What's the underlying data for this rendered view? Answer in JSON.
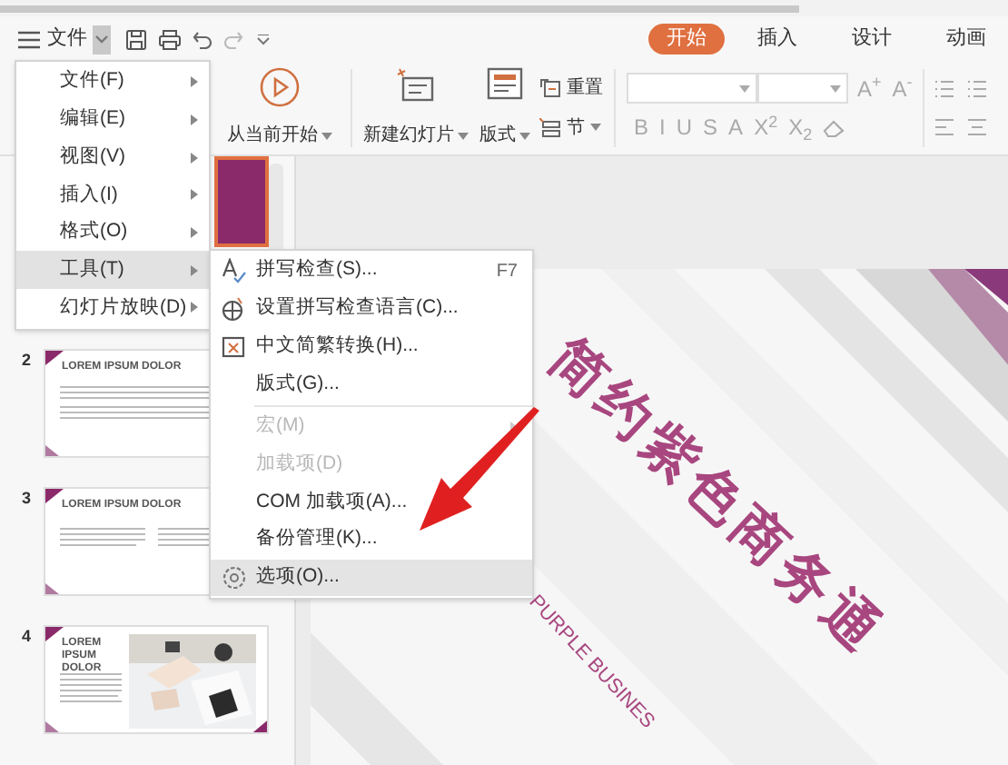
{
  "toolbar": {
    "menu_label": "文件"
  },
  "tabs": [
    {
      "label": "开始",
      "selected": true
    },
    {
      "label": "插入",
      "selected": false
    },
    {
      "label": "设计",
      "selected": false
    },
    {
      "label": "动画",
      "selected": false
    }
  ],
  "ribbon": {
    "play_label": "从当前开始",
    "new_slide_label": "新建幻灯片",
    "layout_label": "版式",
    "reset_label": "重置",
    "section_label": "节",
    "size_buttons": [
      "A$^{+}$",
      "A$^{-}$"
    ],
    "format_buttons": [
      "B",
      "I",
      "U",
      "S",
      "A",
      "X$^{2}$",
      "X$_{2}$"
    ]
  },
  "slides": [
    {
      "number": "2",
      "title": "LOREM IPSUM DOLOR",
      "kind": "text"
    },
    {
      "number": "3",
      "title": "LOREM IPSUM DOLOR",
      "kind": "columns"
    },
    {
      "number": "4",
      "title": "LOREM IPSUM DOLOR"
    }
  ],
  "slide": {
    "title": "简约紫色商务通",
    "subtitle": "PURPLE BUSINES"
  },
  "file_menu": {
    "items": [
      {
        "label": "文件(F)",
        "selected": false
      },
      {
        "label": "编辑(E)",
        "selected": false
      },
      {
        "label": "视图(V)",
        "selected": false
      },
      {
        "label": "插入(I)",
        "selected": false
      },
      {
        "label": "格式(O)",
        "selected": false
      },
      {
        "label": "工具(T)",
        "selected": true
      },
      {
        "label": "幻灯片放映(D)",
        "selected": false
      }
    ]
  },
  "tools_menu": {
    "sections": [
      [
        {
          "label": "拼写检查(S)...",
          "shortcut": "F7",
          "disabled": false,
          "submenu": false,
          "selected": false
        },
        {
          "label": "设置拼写检查语言(C)...",
          "disabled": false,
          "submenu": false,
          "selected": false
        },
        {
          "label": "中文简繁转换(H)...",
          "disabled": false,
          "submenu": false,
          "selected": false
        },
        {
          "label": "版式(G)...",
          "disabled": false,
          "submenu": false,
          "selected": false
        }
      ],
      [
        {
          "label": "宏(M)",
          "disabled": true,
          "submenu": true,
          "selected": false
        },
        {
          "label": "加载项(D)",
          "disabled": true,
          "submenu": false,
          "selected": false
        },
        {
          "label": "COM 加载项(A)...",
          "disabled": false,
          "submenu": false,
          "selected": false
        },
        {
          "label": "备份管理(K)...",
          "disabled": false,
          "submenu": false,
          "selected": false
        },
        {
          "label": "选项(O)...",
          "disabled": false,
          "submenu": false,
          "selected": true
        }
      ]
    ]
  }
}
